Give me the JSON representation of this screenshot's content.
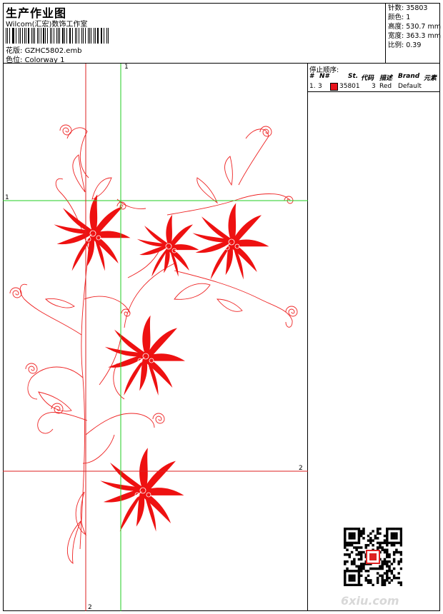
{
  "header": {
    "title": "生产作业图",
    "company": "Wilcom(汇宏)数饰工作室",
    "design_label": "花版:",
    "design_file": "GZHC5802.emb",
    "colorway_label": "色位:",
    "colorway": "Colorway 1"
  },
  "stats": [
    {
      "label": "针数:",
      "value": "35803"
    },
    {
      "label": "颜色:",
      "value": "1"
    },
    {
      "label": "高度:",
      "value": "530.7 mm"
    },
    {
      "label": "宽度:",
      "value": "363.3 mm"
    },
    {
      "label": "比例:",
      "value": "0.39"
    }
  ],
  "guides": {
    "green_vertical": "1",
    "green_horizontal": "1",
    "red_horizontal": "2",
    "red_vertical": "2"
  },
  "stop_sequence": {
    "title": "停止顺序:",
    "columns": {
      "num": "#",
      "needle": "N#",
      "st": "St.",
      "code": "代码",
      "desc": "描述",
      "brand": "Brand",
      "element": "元素"
    },
    "rows": [
      {
        "num": "1.",
        "needle": "3",
        "st": "35801",
        "code": "3",
        "desc": "Red",
        "brand": "Default",
        "color": "#e8141c"
      }
    ]
  },
  "watermark": "6xiu.com",
  "colors": {
    "embroidery": "#ee1111",
    "guide_green": "#22cc22",
    "guide_red": "#dd2222"
  }
}
